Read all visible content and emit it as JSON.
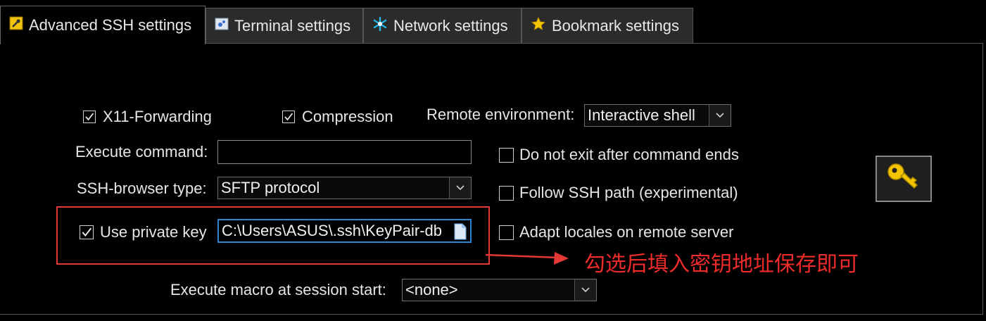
{
  "tabs": [
    {
      "label": "Advanced SSH settings",
      "icon": "wrench-icon",
      "active": true
    },
    {
      "label": "Terminal settings",
      "icon": "terminal-icon",
      "active": false
    },
    {
      "label": "Network settings",
      "icon": "network-icon",
      "active": false
    },
    {
      "label": "Bookmark settings",
      "icon": "star-icon",
      "active": false
    }
  ],
  "options": {
    "x11_forwarding": {
      "label": "X11-Forwarding",
      "checked": true
    },
    "compression": {
      "label": "Compression",
      "checked": true
    },
    "remote_environment": {
      "label": "Remote environment:",
      "value": "Interactive shell"
    },
    "execute_command": {
      "label": "Execute command:",
      "value": ""
    },
    "ssh_browser_type": {
      "label": "SSH-browser type:",
      "value": "SFTP protocol"
    },
    "use_private_key": {
      "label": "Use private key",
      "checked": true,
      "value": "C:\\Users\\ASUS\\.ssh\\KeyPair-db"
    },
    "do_not_exit": {
      "label": "Do not exit after command ends",
      "checked": false
    },
    "follow_ssh_path": {
      "label": "Follow SSH path (experimental)",
      "checked": false
    },
    "adapt_locales": {
      "label": "Adapt locales on remote server",
      "checked": false
    },
    "execute_macro": {
      "label": "Execute macro at session start:",
      "value": "<none>"
    }
  },
  "annotation": {
    "text": "勾选后填入密钥地址保存即可",
    "color": "#ee2b2b"
  },
  "colors": {
    "background": "#000000",
    "text": "#e6e6e6",
    "annotation_red": "#e53935",
    "key_gold": "#f5c400"
  }
}
